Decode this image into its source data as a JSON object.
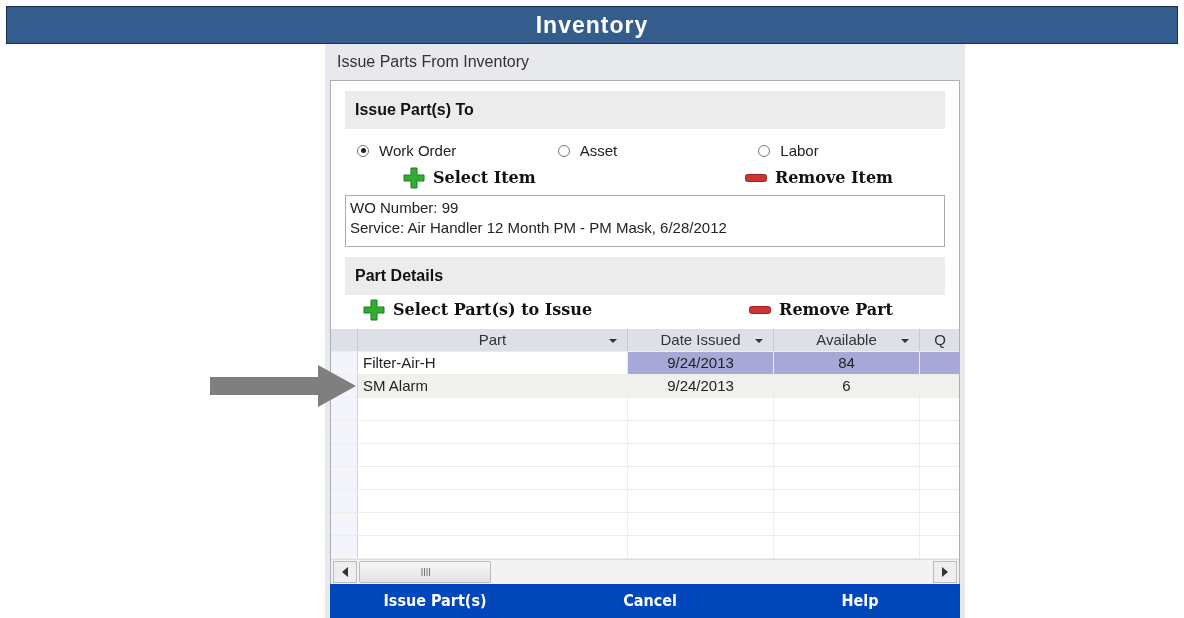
{
  "banner": {
    "title": "Inventory"
  },
  "dialog": {
    "title": "Issue Parts From Inventory"
  },
  "issue_to": {
    "heading": "Issue Part(s) To",
    "options": [
      {
        "label": "Work Order",
        "selected": true
      },
      {
        "label": "Asset",
        "selected": false
      },
      {
        "label": "Labor",
        "selected": false
      }
    ],
    "actions": [
      {
        "kind": "add",
        "label": "Select Item"
      },
      {
        "kind": "remove",
        "label": "Remove Item"
      }
    ],
    "details": [
      "WO Number:  99",
      "Service:  Air Handler 12 Month PM - PM Mask, 6/28/2012"
    ]
  },
  "part_details": {
    "heading": "Part Details",
    "actions": [
      {
        "kind": "add",
        "label": "Select Part(s) to Issue"
      },
      {
        "kind": "remove",
        "label": "Remove Part"
      }
    ],
    "table": {
      "columns": [
        "Part",
        "Date Issued",
        "Available",
        "Q"
      ],
      "rows": [
        {
          "cells": [
            "Filter-Air-H",
            "9/24/2013",
            "84",
            ""
          ],
          "selected": true
        },
        {
          "cells": [
            "SM Alarm",
            "9/24/2013",
            "6",
            ""
          ],
          "selected": false
        }
      ]
    }
  },
  "buttons": [
    "Issue Part(s)",
    "Cancel",
    "Help"
  ]
}
